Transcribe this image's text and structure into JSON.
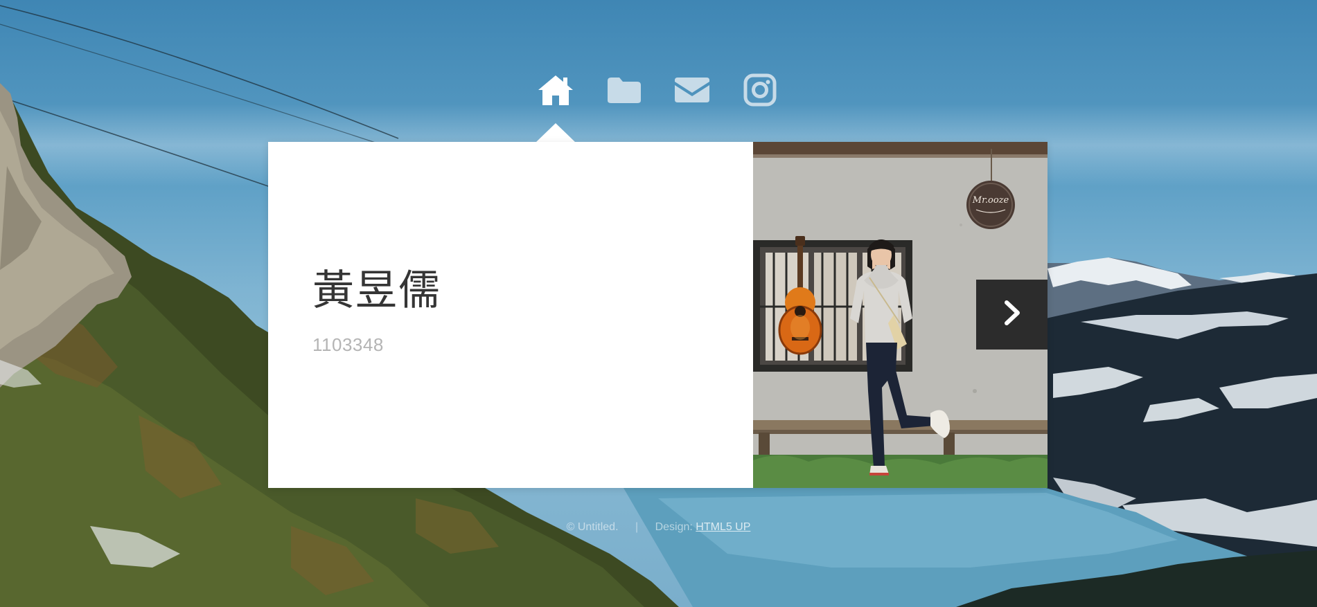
{
  "nav": {
    "items": [
      {
        "icon": "home-icon",
        "active": true
      },
      {
        "icon": "folder-icon",
        "active": false
      },
      {
        "icon": "envelope-icon",
        "active": false
      },
      {
        "icon": "instagram-icon",
        "active": false
      }
    ]
  },
  "intro": {
    "name": "黃昱儒",
    "student_id": "1103348"
  },
  "photo": {
    "sign_text": "Mr.ooze"
  },
  "footer": {
    "copyright": "© Untitled.",
    "separator": "|",
    "design_label": "Design:",
    "design_link": "HTML5 UP"
  },
  "colors": {
    "card": "#ffffff",
    "nav_active": "#ffffff",
    "nav_inactive": "#c7dbe8",
    "next_button": "#2c2c2c",
    "name_text": "#353535",
    "id_text": "#b4b4b4"
  }
}
